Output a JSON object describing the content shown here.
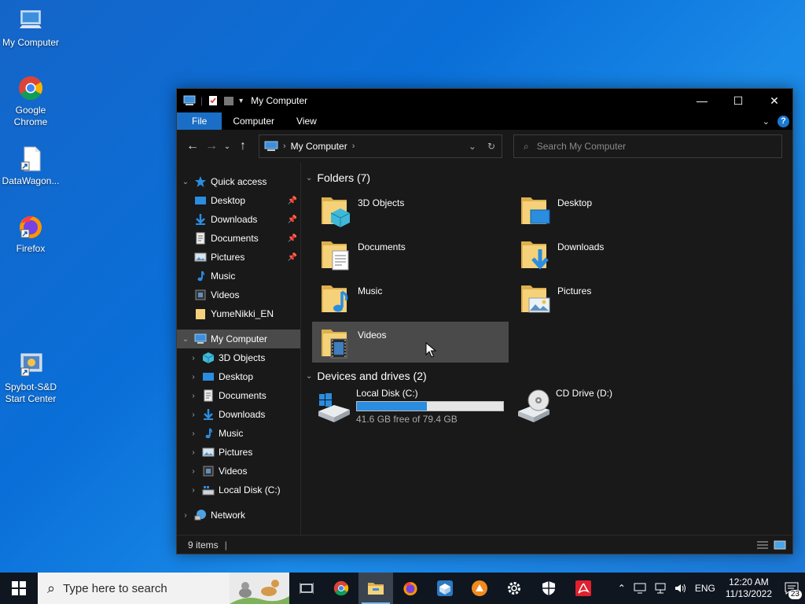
{
  "desktop": {
    "icons": [
      {
        "label": "My Computer",
        "icon": "computer-icon"
      },
      {
        "label": "Google Chrome",
        "icon": "chrome-icon"
      },
      {
        "label": "DataWagon...",
        "icon": "document-shortcut-icon"
      },
      {
        "label": "Firefox",
        "icon": "firefox-icon"
      },
      {
        "label": "Spybot-S&D Start Center",
        "icon": "spybot-icon"
      }
    ]
  },
  "window": {
    "title": "My Computer",
    "controls": {
      "minimize": "—",
      "maximize": "☐",
      "close": "✕"
    },
    "ribbon_tabs": [
      "File",
      "Computer",
      "View"
    ],
    "help": "?",
    "address": {
      "root_sep": "›",
      "location": "My Computer",
      "trail_sep": "›"
    },
    "search_placeholder": "Search My Computer",
    "status": {
      "items": "9 items"
    }
  },
  "navpane": {
    "quick_access": {
      "label": "Quick access",
      "items": [
        {
          "label": "Desktop",
          "pinned": true,
          "icon": "desktop-icon"
        },
        {
          "label": "Downloads",
          "pinned": true,
          "icon": "downloads-icon"
        },
        {
          "label": "Documents",
          "pinned": true,
          "icon": "documents-icon"
        },
        {
          "label": "Pictures",
          "pinned": true,
          "icon": "pictures-icon"
        },
        {
          "label": "Music",
          "pinned": false,
          "icon": "music-icon"
        },
        {
          "label": "Videos",
          "pinned": false,
          "icon": "videos-icon"
        },
        {
          "label": "YumeNikki_EN",
          "pinned": false,
          "icon": "folder-icon"
        }
      ]
    },
    "my_computer": {
      "label": "My Computer",
      "items": [
        {
          "label": "3D Objects",
          "icon": "3d-objects-icon"
        },
        {
          "label": "Desktop",
          "icon": "desktop-icon"
        },
        {
          "label": "Documents",
          "icon": "documents-icon"
        },
        {
          "label": "Downloads",
          "icon": "downloads-icon"
        },
        {
          "label": "Music",
          "icon": "music-icon"
        },
        {
          "label": "Pictures",
          "icon": "pictures-icon"
        },
        {
          "label": "Videos",
          "icon": "videos-icon"
        },
        {
          "label": "Local Disk (C:)",
          "icon": "drive-icon"
        }
      ]
    },
    "network": {
      "label": "Network"
    }
  },
  "content": {
    "folders_header": "Folders (7)",
    "folders": [
      {
        "name": "3D Objects",
        "overlay": "cube"
      },
      {
        "name": "Desktop",
        "overlay": "monitor"
      },
      {
        "name": "Documents",
        "overlay": "document"
      },
      {
        "name": "Downloads",
        "overlay": "arrow"
      },
      {
        "name": "Music",
        "overlay": "note"
      },
      {
        "name": "Pictures",
        "overlay": "picture"
      },
      {
        "name": "Videos",
        "overlay": "film"
      }
    ],
    "drives_header": "Devices and drives (2)",
    "drives": [
      {
        "name": "Local Disk (C:)",
        "free": "41.6 GB free of 79.4 GB",
        "used_fraction": 0.476
      },
      {
        "name": "CD Drive (D:)"
      }
    ]
  },
  "taskbar": {
    "search_placeholder": "Type here to search",
    "language": "ENG",
    "time": "12:20 AM",
    "date": "11/13/2022",
    "notification_count": "23"
  },
  "colors": {
    "accent": "#1a6ec5",
    "selection": "#4a4a4a",
    "progress": "#2a8de0"
  }
}
